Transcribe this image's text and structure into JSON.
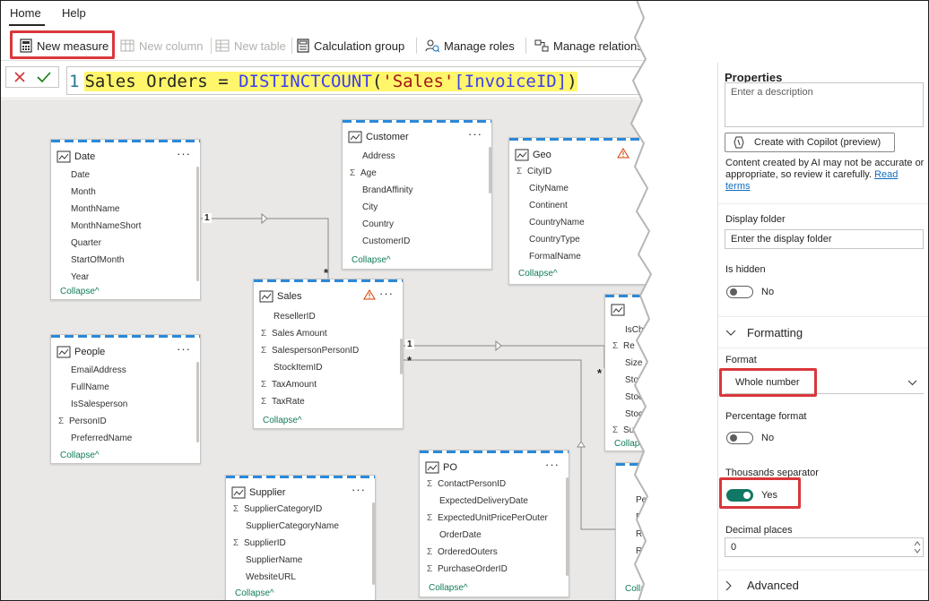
{
  "ribbon": {
    "tabs": [
      "Home",
      "Help"
    ],
    "buttons": {
      "new_measure": "New measure",
      "new_column": "New column",
      "new_table": "New table",
      "calculation_group": "Calculation group",
      "manage_roles": "Manage roles",
      "manage_relationships": "Manage relations"
    }
  },
  "formula": {
    "line_number": "1",
    "measure_name": "Sales Orders",
    "equals": "=",
    "function": "DISTINCTCOUNT",
    "open_paren": "(",
    "table": "'Sales'",
    "column": "[InvoiceID]",
    "close_paren": ")"
  },
  "model": {
    "date": {
      "name": "Date",
      "fields": [
        "Date",
        "Month",
        "MonthName",
        "MonthNameShort",
        "Quarter",
        "StartOfMonth",
        "Year"
      ],
      "collapse": "Collapse"
    },
    "people": {
      "name": "People",
      "fields": [
        "EmailAddress",
        "FullName",
        "IsSalesperson",
        "PersonID",
        "PreferredName"
      ],
      "collapse": "Collapse"
    },
    "customer": {
      "name": "Customer",
      "fields": [
        "Address",
        "Age",
        "BrandAffinity",
        "City",
        "Country",
        "CustomerID"
      ],
      "collapse": "Collapse"
    },
    "geo": {
      "name": "Geo",
      "fields": [
        "CityID",
        "CityName",
        "Continent",
        "CountryName",
        "CountryType",
        "FormalName"
      ],
      "collapse": "Collapse"
    },
    "sales": {
      "name": "Sales",
      "fields": [
        "ResellerID",
        "Sales Amount",
        "SalespersonPersonID",
        "StockItemID",
        "TaxAmount",
        "TaxRate"
      ],
      "collapse": "Collapse"
    },
    "supplier": {
      "name": "Supplier",
      "fields": [
        "SupplierCategoryID",
        "SupplierCategoryName",
        "SupplierID",
        "SupplierName",
        "WebsiteURL"
      ],
      "collapse": "Collapse"
    },
    "po": {
      "name": "PO",
      "fields": [
        "ContactPersonID",
        "ExpectedDeliveryDate",
        "ExpectedUnitPricePerOuter",
        "OrderDate",
        "OrderedOuters",
        "PurchaseOrderID"
      ],
      "collapse": "Collapse"
    },
    "partial_right": {
      "fields": [
        "IsChil",
        "Re",
        "Size",
        "Stoc",
        "Stoc",
        "Stoc",
        "Supp"
      ],
      "collapse": "Collap"
    },
    "partial_bottom": {
      "fields": [
        "Pe",
        "Re",
        "Re",
        "Re",
        "W"
      ],
      "collapse": "Collap"
    },
    "relationship_labels": {
      "one": "1",
      "many": "*"
    }
  },
  "properties": {
    "title": "Properties",
    "description_placeholder": "Enter a description",
    "copilot_button": "Create with Copilot (preview)",
    "ai_note": "Content created by AI may not be accurate or appropriate, so review it carefully.",
    "ai_note_link": "Read terms",
    "display_folder_label": "Display folder",
    "display_folder_placeholder": "Enter the display folder",
    "is_hidden_label": "Is hidden",
    "is_hidden_value": "No",
    "formatting_section": "Formatting",
    "format_label": "Format",
    "format_value": "Whole number",
    "percentage_label": "Percentage format",
    "percentage_value": "No",
    "thousands_label": "Thousands separator",
    "thousands_value": "Yes",
    "decimal_label": "Decimal places",
    "decimal_value": "0",
    "advanced_section": "Advanced"
  },
  "colors": {
    "highlight_box": "#d9373b",
    "formula_highlight": "#fff66b",
    "toggle_on": "#117865",
    "table_header_dash": "#2b88d8",
    "collapse_link": "#107c57"
  }
}
